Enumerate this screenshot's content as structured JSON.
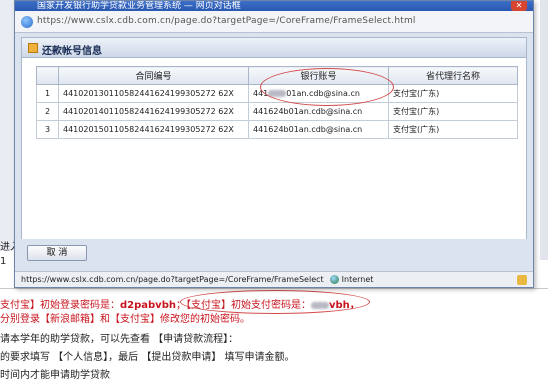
{
  "window": {
    "title": "国家开发银行助学贷款业务管理系统 — 网页对话框",
    "address": "https://www.cslx.cdb.com.cn/page.do?targetPage=/CoreFrame/FrameSelect.html",
    "close_label": "✕"
  },
  "section": {
    "title": "还款帐号信息"
  },
  "table": {
    "headers": [
      "",
      "合同编号",
      "银行账号",
      "省代理行名称"
    ],
    "rows": [
      {
        "n": "1",
        "contract": "441020130110582441624199305272 62X",
        "account_pre": "441",
        "account_post": "01an.cdb@sina.cn",
        "bank": "支付宝(广东)"
      },
      {
        "n": "2",
        "contract": "441020140110582441624199305272 62X",
        "account_pre": "441624b01an.cdb@sina.cn",
        "account_post": "",
        "bank": "支付宝(广东)"
      },
      {
        "n": "3",
        "contract": "441020150110582441624199305272 62X",
        "account_pre": "441624b01an.cdb@sina.cn",
        "account_post": "",
        "bank": "支付宝(广东)"
      }
    ]
  },
  "footer": {
    "cancel_label": "取 消"
  },
  "status": {
    "url": "https://www.cslx.cdb.com.cn/page.do?targetPage=/CoreFrame/FrameSelect",
    "zone": "Internet"
  },
  "background": {
    "row1": "进入",
    "row2": "1",
    "line1_pre": "支付宝】初始登录密码是：",
    "line1_pw": "d2pabvbh",
    "line1_mid": "；【支付宝】初始支付密码是：",
    "line1_end": "vbh，",
    "line2": "分别登录【新浪邮箱】和【支付宝】修改您的初始密码。",
    "line3": "请本学年的助学贷款，可以先查看 【申请贷款流程】：",
    "line4": "的要求填写 【个人信息】，最后 【提出贷款申请】 填写申请金额。",
    "line5": "时间内才能申请助学贷款"
  }
}
